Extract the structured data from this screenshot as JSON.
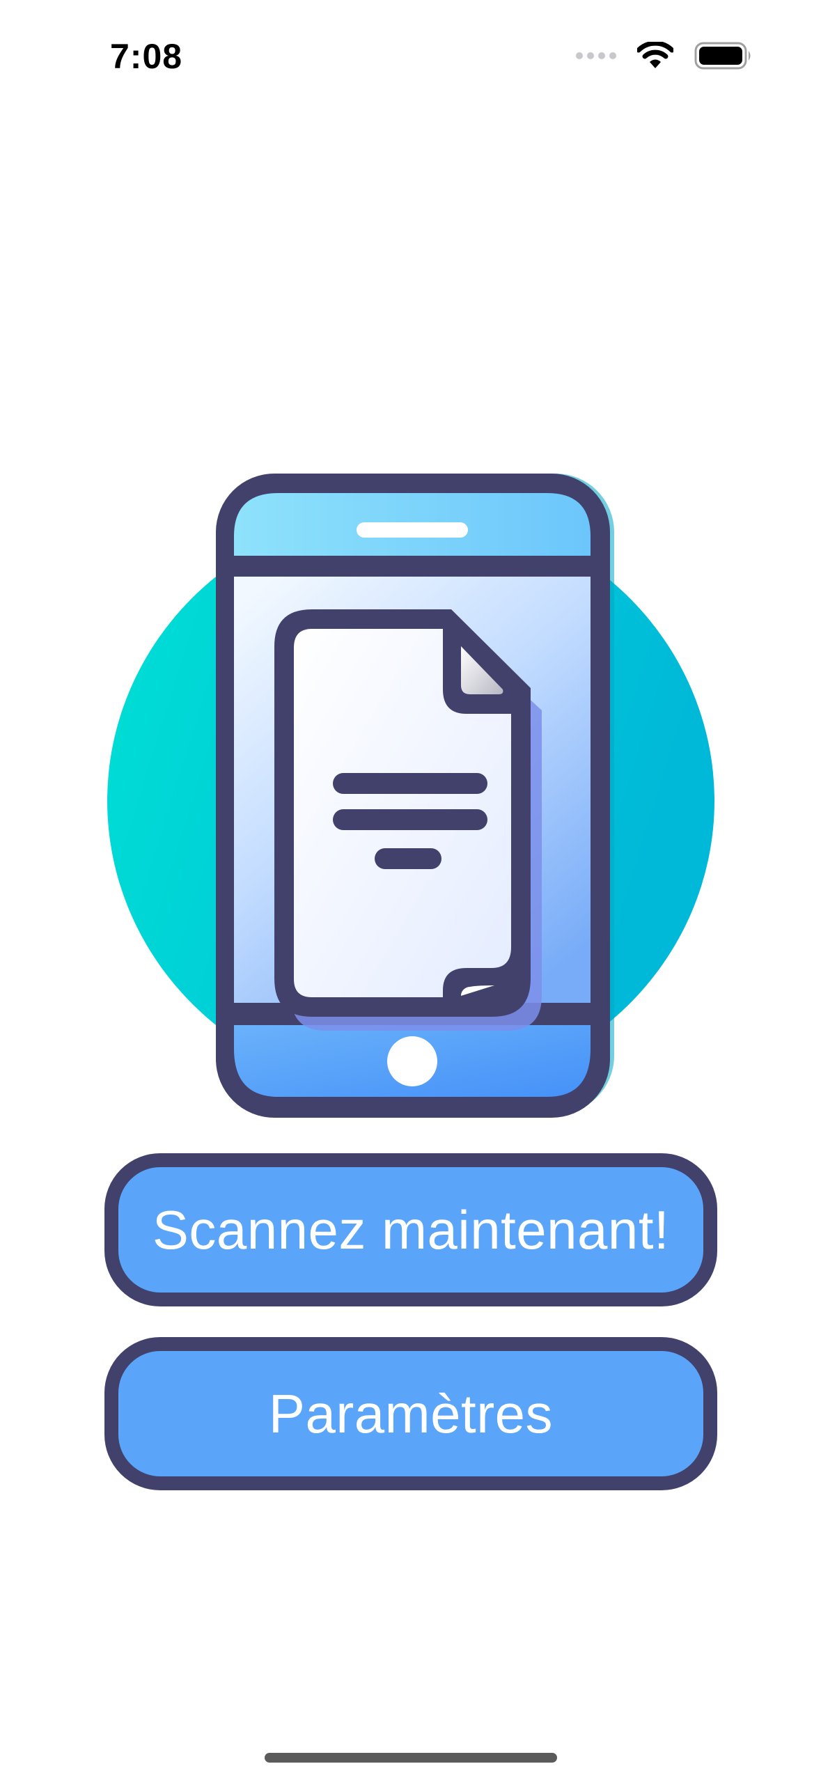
{
  "status_bar": {
    "time": "7:08"
  },
  "illustration": {
    "icon_name": "phone-document-icon",
    "colors": {
      "circle_start": "#00e0d6",
      "circle_end": "#00b8d8",
      "outline": "#41416b",
      "screen_light": "#eef6ff",
      "screen_blue": "#5aa5fa",
      "page_shadow": "#7c8fea"
    }
  },
  "buttons": {
    "scan_label": "Scannez maintenant!",
    "settings_label": "Paramètres"
  },
  "colors": {
    "button_fill": "#5aa5fa",
    "button_border": "#41416b",
    "button_text": "#ffffff"
  }
}
